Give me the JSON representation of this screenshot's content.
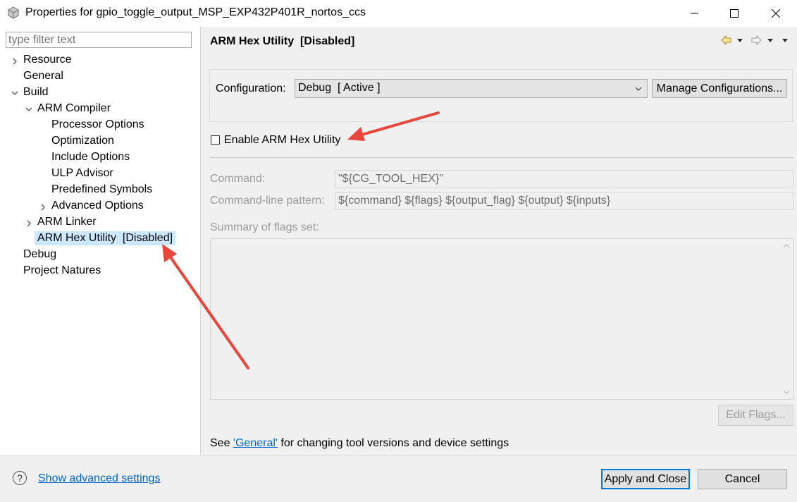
{
  "window": {
    "title": "Properties for gpio_toggle_output_MSP_EXP432P401R_nortos_ccs",
    "icons": [
      "app-icon",
      "minimize-icon",
      "maximize-icon",
      "close-icon"
    ]
  },
  "sidebar": {
    "filter_placeholder": "type filter text",
    "items": [
      {
        "label": "Resource",
        "expander": "collapsed"
      },
      {
        "label": "General"
      },
      {
        "label": "Build",
        "expander": "expanded"
      },
      {
        "label": "ARM Compiler",
        "expander": "expanded"
      },
      {
        "label": "Processor Options"
      },
      {
        "label": "Optimization"
      },
      {
        "label": "Include Options"
      },
      {
        "label": "ULP Advisor"
      },
      {
        "label": "Predefined Symbols"
      },
      {
        "label": "Advanced Options",
        "expander": "collapsed"
      },
      {
        "label": "ARM Linker",
        "expander": "collapsed"
      },
      {
        "label": "ARM Hex Utility  [Disabled]",
        "selected": true
      },
      {
        "label": "Debug"
      },
      {
        "label": "Project Natures"
      }
    ]
  },
  "main": {
    "title": "ARM Hex Utility  [Disabled]",
    "nav_icons": [
      "back-arrow-icon",
      "dropdown-icon",
      "forward-arrow-icon",
      "dropdown-icon",
      "menu-icon"
    ],
    "configuration_label": "Configuration:",
    "configuration_value": "Debug  [ Active ]",
    "manage_button": "Manage Configurations...",
    "enable_checkbox_label": "Enable ARM Hex Utility",
    "enable_checked": false,
    "command_label": "Command:",
    "command_value": "\"${CG_TOOL_HEX}\"",
    "pattern_label": "Command-line pattern:",
    "pattern_value": "${command} ${flags} ${output_flag} ${output} ${inputs}",
    "summary_label": "Summary of flags set:",
    "edit_flags_button": "Edit Flags...",
    "footer_prefix": "See ",
    "footer_link": "'General'",
    "footer_suffix": " for changing tool versions and device settings"
  },
  "bottom": {
    "advanced_link": "Show advanced settings",
    "apply_button": "Apply and Close",
    "cancel_button": "Cancel"
  },
  "colors": {
    "selection": "#cce8ff",
    "link": "#0066cc",
    "default_button_border": "#0078d7",
    "annotation_arrow": "#e8453c"
  }
}
